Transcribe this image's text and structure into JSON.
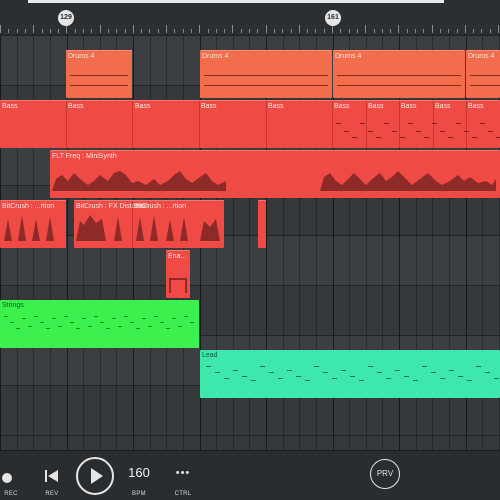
{
  "ruler": {
    "markers": [
      "129",
      "161"
    ]
  },
  "tracks": [
    {
      "clips": [
        {
          "label": "Drums 4",
          "color": "orange"
        },
        {
          "label": "Drums 4",
          "color": "orange"
        },
        {
          "label": "Drums 4",
          "color": "orange"
        },
        {
          "label": "Drums 4",
          "color": "orange"
        }
      ]
    },
    {
      "clips": [
        {
          "label": "Bass"
        },
        {
          "label": "Bass"
        },
        {
          "label": "Bass"
        },
        {
          "label": "Bass"
        },
        {
          "label": "Bass"
        },
        {
          "label": "Bass"
        },
        {
          "label": "Bass"
        },
        {
          "label": "Bass"
        },
        {
          "label": "Bass"
        },
        {
          "label": "Bass"
        },
        {
          "label": "Bass"
        }
      ]
    },
    {
      "clips": [
        {
          "label": "FLT Freq : MiniSynth"
        }
      ]
    },
    {
      "clips": [
        {
          "label": "BitCrush : ...rtion"
        },
        {
          "label": "BitCrush : FX Distortion"
        },
        {
          "label": "BitCrush : ...rtion"
        },
        {
          "label": ""
        }
      ]
    },
    {
      "clips": [
        {
          "label": "Ena..."
        }
      ]
    },
    {
      "clips": [
        {
          "label": "Strings"
        }
      ]
    },
    {
      "clips": [
        {
          "label": "Lead"
        }
      ]
    }
  ],
  "transport": {
    "rec": "REC",
    "rev": "REV",
    "bpm_value": "160",
    "bpm": "BPM",
    "ctrl": "CTRL",
    "ctrl_glyph": "•••",
    "prv": "PRV"
  },
  "colors": {
    "orange": "#f16d4b",
    "red": "#f04a45",
    "green": "#3cf04d",
    "teal": "#3ee8ad"
  }
}
